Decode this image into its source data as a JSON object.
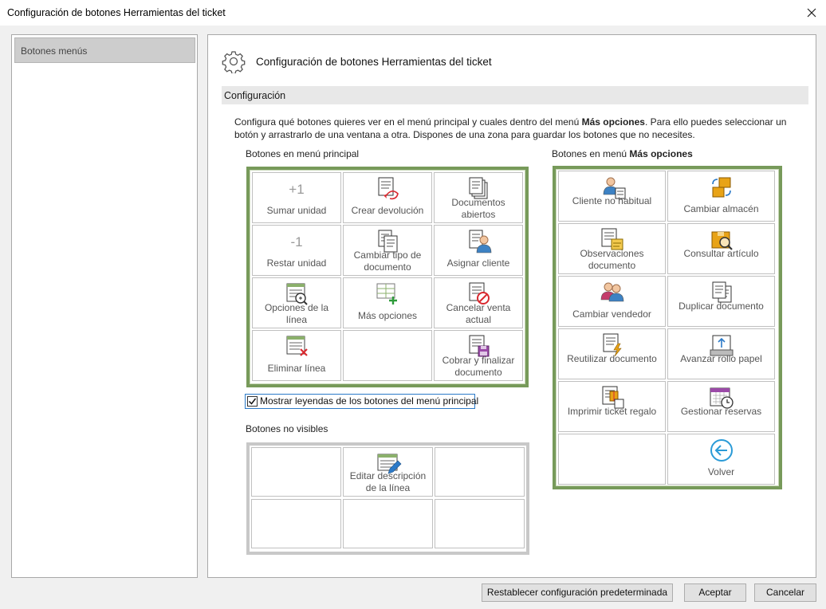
{
  "window": {
    "title": "Configuración de botones Herramientas del ticket"
  },
  "sidebar": {
    "items": [
      {
        "label": "Botones menús"
      }
    ]
  },
  "main": {
    "title": "Configuración de botones Herramientas del ticket",
    "section": "Configuración",
    "description_part1": "Configura qué botones quieres ver en el menú principal y cuales dentro del menú ",
    "description_bold": "Más opciones",
    "description_part2": ". Para ello puedes seleccionar un",
    "description_line2": "botón y arrastrarlo de una ventana a otra. Dispones de una zona para guardar los botones que no necesites."
  },
  "principal": {
    "label": "Botones en menú principal",
    "buttons": [
      {
        "label": "Sumar unidad",
        "icon": "plus-one-icon"
      },
      {
        "label": "Crear devolución",
        "icon": "return-document-icon"
      },
      {
        "label": "Documentos abiertos",
        "icon": "open-documents-icon"
      },
      {
        "label": "Restar unidad",
        "icon": "minus-one-icon"
      },
      {
        "label": "Cambiar tipo de documento",
        "icon": "change-document-type-icon"
      },
      {
        "label": "Asignar cliente",
        "icon": "assign-customer-icon"
      },
      {
        "label": "Opciones de la línea",
        "icon": "line-options-icon"
      },
      {
        "label": "Más opciones",
        "icon": "more-options-icon"
      },
      {
        "label": "Cancelar venta actual",
        "icon": "cancel-sale-icon"
      },
      {
        "label": "Eliminar línea",
        "icon": "delete-line-icon"
      },
      {
        "label": "",
        "icon": ""
      },
      {
        "label": "Cobrar y finalizar documento",
        "icon": "checkout-icon"
      }
    ]
  },
  "mas_opciones": {
    "label_prefix": "Botones en menú ",
    "label_bold": "Más opciones",
    "buttons": [
      {
        "label": "Cliente no habitual",
        "icon": "walk-in-customer-icon"
      },
      {
        "label": "Cambiar almacén",
        "icon": "change-warehouse-icon"
      },
      {
        "label": "Observaciones documento",
        "icon": "document-notes-icon"
      },
      {
        "label": "Consultar artículo",
        "icon": "search-item-icon"
      },
      {
        "label": "Cambiar vendedor",
        "icon": "change-seller-icon"
      },
      {
        "label": "Duplicar documento",
        "icon": "duplicate-document-icon"
      },
      {
        "label": "Reutilizar documento",
        "icon": "reuse-document-icon"
      },
      {
        "label": "Avanzar rollo papel",
        "icon": "advance-paper-icon"
      },
      {
        "label": "Imprimir ticket regalo",
        "icon": "gift-ticket-icon"
      },
      {
        "label": "Gestionar reservas",
        "icon": "manage-reservations-icon"
      },
      {
        "label": "",
        "icon": ""
      },
      {
        "label": "Volver",
        "icon": "back-arrow-icon"
      }
    ]
  },
  "checkbox": {
    "label": "Mostrar leyendas de los botones del menú principal",
    "checked": true
  },
  "no_visibles": {
    "label": "Botones no visibles",
    "buttons": [
      {
        "label": "",
        "icon": ""
      },
      {
        "label": "Editar descripción de la línea",
        "icon": "edit-line-description-icon"
      },
      {
        "label": "",
        "icon": ""
      },
      {
        "label": "",
        "icon": ""
      },
      {
        "label": "",
        "icon": ""
      },
      {
        "label": "",
        "icon": ""
      }
    ]
  },
  "footer": {
    "reset_label": "Restablecer configuración predeterminada",
    "accept_label": "Aceptar",
    "cancel_label": "Cancelar"
  },
  "colors": {
    "grid_border": "#779a5a",
    "accent_red": "#d9292f",
    "accent_orange": "#e8a317",
    "accent_blue": "#2b7ac8"
  }
}
